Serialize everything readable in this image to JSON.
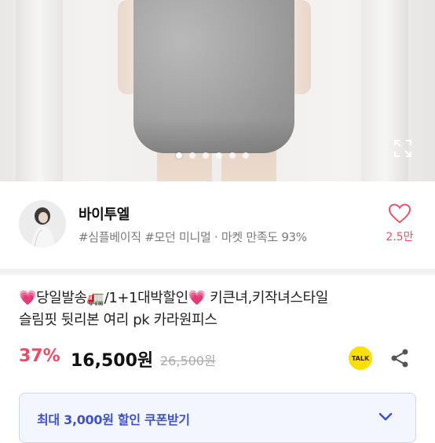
{
  "carousel": {
    "slide_count": 6,
    "active_index": 0
  },
  "seller": {
    "name": "바이투엘",
    "tags": "#심플베이직 #모던 미니멀 · 마켓 만족도 93%",
    "likes": "2.5만"
  },
  "product": {
    "title_prefix": "💗당일발송🚛/1+1대박할인💗 키큰녀,키작녀스타일",
    "title_line2": "슬림핏 뒷리본 여리 pk 카라원피스",
    "discount": "37%",
    "price": "16,500원",
    "original_price": "26,500원",
    "talk_label": "TALK"
  },
  "coupon": {
    "label": "최대 3,000원 할인 쿠폰받기"
  },
  "colors": {
    "accent_pink": "#ec4b66",
    "coupon_blue": "#3f53c7",
    "kakao_yellow": "#f9e000"
  }
}
